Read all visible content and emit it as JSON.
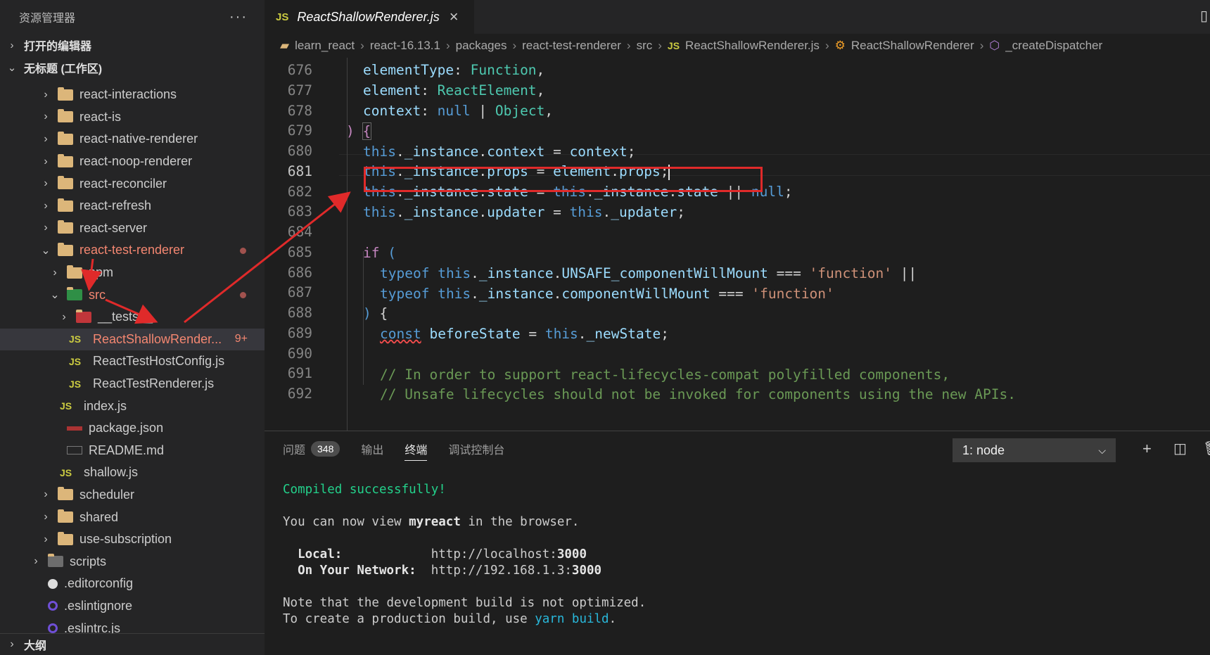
{
  "sidebar": {
    "title": "资源管理器",
    "more": "···",
    "open_editors": "打开的编辑器",
    "workspace": "无标题 (工作区)",
    "outline": "大纲",
    "tree": [
      {
        "label": "react-interactions",
        "type": "folder"
      },
      {
        "label": "react-is",
        "type": "folder"
      },
      {
        "label": "react-native-renderer",
        "type": "folder"
      },
      {
        "label": "react-noop-renderer",
        "type": "folder"
      },
      {
        "label": "react-reconciler",
        "type": "folder"
      },
      {
        "label": "react-refresh",
        "type": "folder"
      },
      {
        "label": "react-server",
        "type": "folder"
      },
      {
        "label": "react-test-renderer",
        "type": "folder-open"
      },
      {
        "label": "npm",
        "type": "folder"
      },
      {
        "label": "src",
        "type": "folder-src"
      },
      {
        "label": "__tests__",
        "type": "folder-tests"
      },
      {
        "label": "ReactShallowRender...",
        "type": "js",
        "badge": "9+"
      },
      {
        "label": "ReactTestHostConfig.js",
        "type": "js"
      },
      {
        "label": "ReactTestRenderer.js",
        "type": "js"
      },
      {
        "label": "index.js",
        "type": "js"
      },
      {
        "label": "package.json",
        "type": "json"
      },
      {
        "label": "README.md",
        "type": "md"
      },
      {
        "label": "shallow.js",
        "type": "js"
      },
      {
        "label": "scheduler",
        "type": "folder"
      },
      {
        "label": "shared",
        "type": "folder"
      },
      {
        "label": "use-subscription",
        "type": "folder"
      },
      {
        "label": "scripts",
        "type": "folder-scripts"
      },
      {
        "label": ".editorconfig",
        "type": "config"
      },
      {
        "label": ".eslintignore",
        "type": "eslint"
      },
      {
        "label": ".eslintrc.js",
        "type": "eslint"
      }
    ],
    "js_tag": "JS"
  },
  "editor": {
    "tab_title": "ReactShallowRenderer.js",
    "breadcrumbs": [
      "learn_react",
      "react-16.13.1",
      "packages",
      "react-test-renderer",
      "src",
      "ReactShallowRenderer.js",
      "ReactShallowRenderer",
      "_createDispatcher"
    ],
    "line_numbers": [
      "676",
      "677",
      "678",
      "679",
      "680",
      "681",
      "682",
      "683",
      "684",
      "685",
      "686",
      "687",
      "688",
      "689",
      "690",
      "691",
      "692"
    ]
  },
  "panel": {
    "tabs": [
      "问题",
      "输出",
      "终端",
      "调试控制台"
    ],
    "problems_count": "348",
    "terminal_select": "1: node",
    "terminal": {
      "compiled": "Compiled successfully!",
      "view_pre": "You can now view ",
      "app": "myreact",
      "view_post": " in the browser.",
      "local_label": "  Local:",
      "local_url_pre": "http://localhost:",
      "local_port": "3000",
      "net_label": "  On Your Network:",
      "net_url_pre": "http://192.168.1.3:",
      "net_port": "3000",
      "note": "Note that the development build is not optimized.",
      "create_pre": "To create a production build, use ",
      "create_cmd": "yarn build",
      "create_post": "."
    }
  },
  "colors": {
    "annotation": "#e02a2a",
    "accent": "#007acc"
  }
}
